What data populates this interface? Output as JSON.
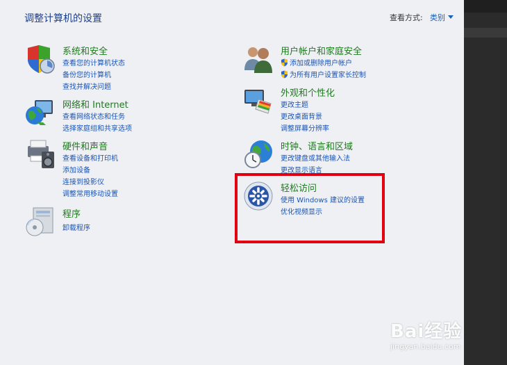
{
  "header": {
    "title": "调整计算机的设置",
    "view_by_label": "查看方式:",
    "view_by_value": "类别"
  },
  "categories": {
    "system": {
      "title": "系统和安全",
      "icon": "system-security-icon",
      "links": [
        "查看您的计算机状态",
        "备份您的计算机",
        "查找并解决问题"
      ]
    },
    "network": {
      "title": "网络和 Internet",
      "icon": "network-internet-icon",
      "links": [
        "查看网络状态和任务",
        "选择家庭组和共享选项"
      ]
    },
    "hardware": {
      "title": "硬件和声音",
      "icon": "hardware-sound-icon",
      "links": [
        "查看设备和打印机",
        "添加设备",
        "连接到投影仪",
        "调整常用移动设置"
      ]
    },
    "programs": {
      "title": "程序",
      "icon": "programs-icon",
      "links": [
        "卸载程序"
      ]
    },
    "users": {
      "title": "用户帐户和家庭安全",
      "icon": "user-accounts-icon",
      "links": [
        "添加或删除用户帐户",
        "为所有用户设置家长控制"
      ]
    },
    "appearance": {
      "title": "外观和个性化",
      "icon": "appearance-personalization-icon",
      "links": [
        "更改主题",
        "更改桌面背景",
        "调整屏幕分辨率"
      ]
    },
    "clock": {
      "title": "时钟、语言和区域",
      "icon": "clock-language-region-icon",
      "links": [
        "更改键盘或其他输入法",
        "更改显示语言"
      ]
    },
    "access": {
      "title": "轻松访问",
      "icon": "ease-of-access-icon",
      "links": [
        "使用 Windows 建议的设置",
        "优化视频显示"
      ]
    }
  },
  "watermark": {
    "logo_text": "Bai经验",
    "url": "jingyan.baidu.com"
  },
  "colors": {
    "title": "#1e3f8a",
    "category_heading": "#1e7a1e",
    "link": "#1c55b5",
    "highlight_box": "#e0000f",
    "background": "#eef0f3"
  }
}
